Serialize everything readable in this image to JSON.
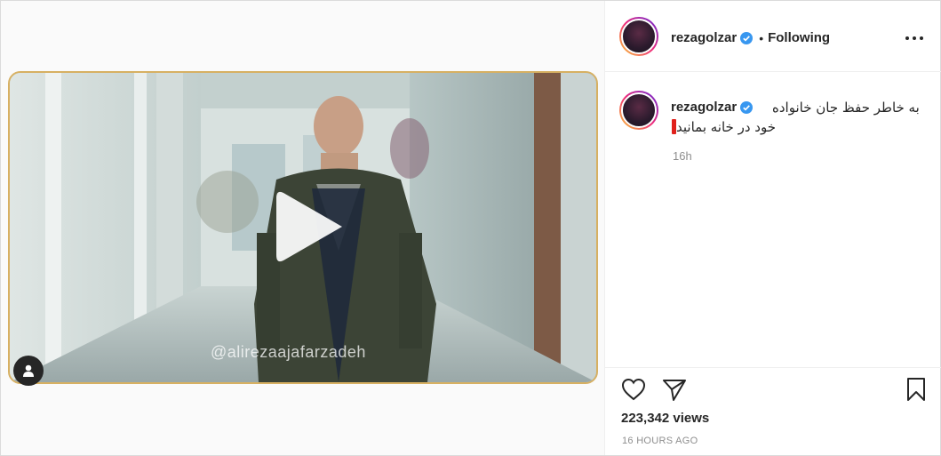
{
  "post": {
    "video": {
      "watermark": "@alirezaajafarzadeh"
    },
    "header": {
      "username": "rezagolzar",
      "separator": "•",
      "follow_status": "Following"
    },
    "caption": {
      "username": "rezagolzar",
      "line1": "به خاطر حفظ جان خانواده",
      "line2": "خود در خانه بمانید",
      "time": "16h"
    },
    "stats": {
      "views": "223,342 views",
      "posted": "16 HOURS AGO"
    },
    "icons": {
      "verified": "verified-badge-icon",
      "more": "more-options-icon",
      "like": "heart-icon",
      "share": "paper-plane-icon",
      "save": "bookmark-icon",
      "play": "play-icon",
      "tag": "user-tag-icon"
    },
    "colors": {
      "verified": "#3897f0",
      "frame_border": "#d7b062",
      "muted": "#8e8e8e",
      "text": "#262626"
    }
  }
}
